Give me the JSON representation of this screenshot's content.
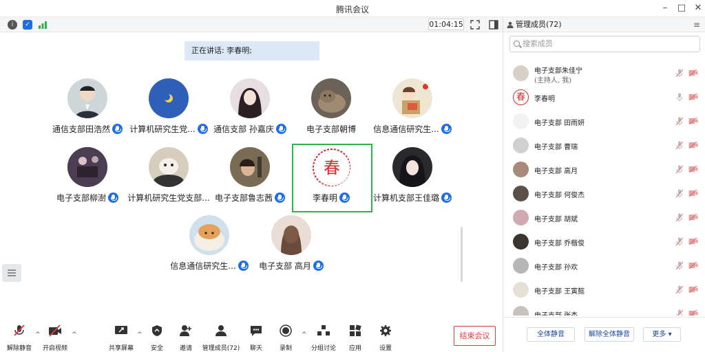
{
  "window": {
    "title": "腾讯会议"
  },
  "topbar": {
    "timer": "01:04:15"
  },
  "speaking": {
    "text": "正在讲话: 李春明;"
  },
  "participants": [
    {
      "name": "通信支部田浩然"
    },
    {
      "name": "计算机研究生党..."
    },
    {
      "name": "通信支部  孙嘉庆"
    },
    {
      "name": "电子支部朝博"
    },
    {
      "name": "信息通信研究生..."
    },
    {
      "name": "电子支部柳澍"
    },
    {
      "name": "计算机研究生党支部..."
    },
    {
      "name": "电子支部鲁志茜"
    },
    {
      "name": "李春明",
      "avatar_glyph": "春"
    },
    {
      "name": "计算机支部王佳璐"
    },
    {
      "name": "信息通信研究生..."
    },
    {
      "name": "电子支部  高月"
    }
  ],
  "toolbar": {
    "unmute": "解除静音",
    "start_video": "开启视频",
    "share_screen": "共享屏幕",
    "security": "安全",
    "invite": "邀请",
    "manage_members": "管理成员(72)",
    "chat": "聊天",
    "record": "录制",
    "breakout": "分组讨论",
    "apps": "应用",
    "settings": "设置",
    "end_meeting": "结束会议"
  },
  "panel": {
    "title": "管理成员(72)",
    "search_placeholder": "搜索成员",
    "members": [
      {
        "name": "电子支部朱佳宁",
        "sub": "(主持人, 我)"
      },
      {
        "name": "李春明",
        "avatar_glyph": "春"
      },
      {
        "name": "电子支部  田雨妍"
      },
      {
        "name": "电子支部  曹瑞"
      },
      {
        "name": "电子支部  高月"
      },
      {
        "name": "电子支部  何俊杰"
      },
      {
        "name": "电子支部  胡斌"
      },
      {
        "name": "电子支部  乔楷俊"
      },
      {
        "name": "电子支部  孙欢"
      },
      {
        "name": "电子支部  王寅懿"
      },
      {
        "name": "电子支部  张杰"
      }
    ],
    "mute_all": "全体静音",
    "unmute_all": "解除全体静音",
    "more": "更多"
  },
  "colors": {
    "accent": "#1b6ee6",
    "danger": "#e03c3c",
    "active_border": "#2fb14b"
  }
}
